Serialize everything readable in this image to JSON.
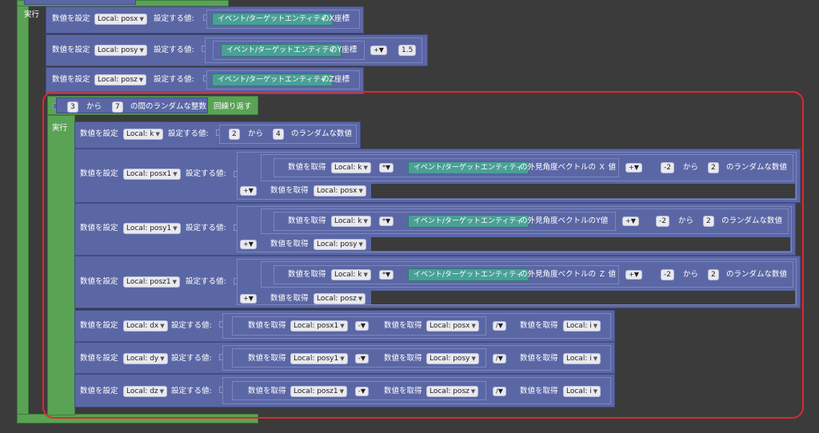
{
  "labels": {
    "exec": "実行",
    "set_value": "数値を設定",
    "set_to": "設定する値:",
    "get_value": "数値を取得",
    "from": "から",
    "random_number": "のランダムな数値",
    "between": "の間のランダムな整数",
    "repeat": "回繰り返す",
    "x_coord": "のX座標",
    "y_coord": "のY座標",
    "z_coord": "のZ座標",
    "look_x": "の外見角度ベクトルの Ｘ 値",
    "look_y": "の外見角度ベクトルのY値",
    "look_z": "の外見角度ベクトルの Ｚ 値"
  },
  "entity": "イベント/ターゲットエンティティ",
  "ops": {
    "plus": "+",
    "times": "*",
    "minus": "-",
    "divide": "/"
  },
  "dropdown_arrow": "▼",
  "vars": {
    "posx": "Local: posx",
    "posy": "Local: posy",
    "posz": "Local: posz",
    "k": "Local: k",
    "i": "Local: i",
    "posx1": "Local: posx1",
    "posy1": "Local: posy1",
    "posz1": "Local: posz1",
    "dx": "Local: dx",
    "dy": "Local: dy",
    "dz": "Local: dz"
  },
  "nums": {
    "offset": "1.5",
    "rep_from": "3",
    "rep_to": "7",
    "k_from": "2",
    "k_to": "4",
    "r_from": "-2",
    "r_to": "2"
  },
  "colors": {
    "background": "#3b3b3b",
    "event_block": "#5aa355",
    "math_block": "#5b67a5",
    "entity_block": "#4aa096",
    "highlight": "#e0282f"
  }
}
